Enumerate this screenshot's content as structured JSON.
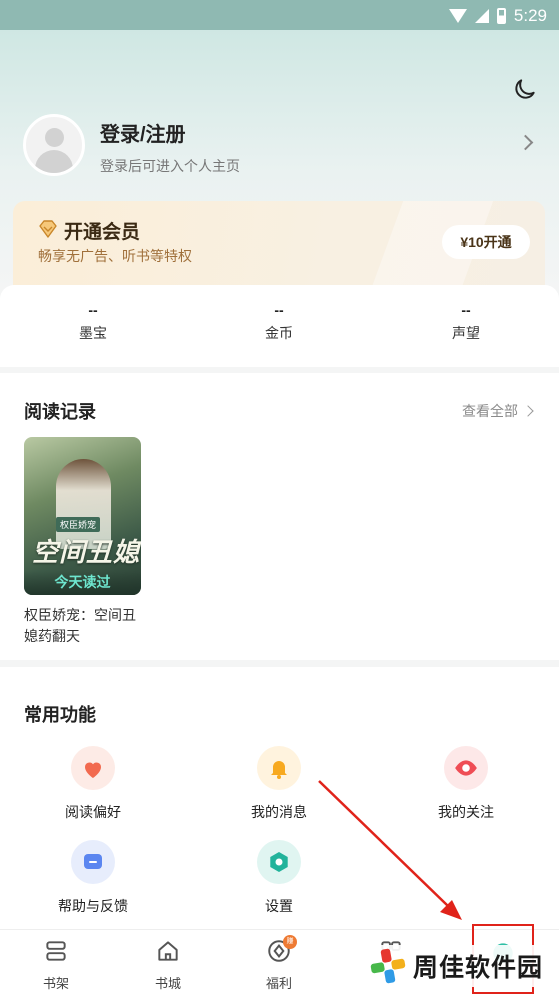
{
  "status_bar": {
    "time": "5:29"
  },
  "profile": {
    "title": "登录/注册",
    "subtitle": "登录后可进入个人主页"
  },
  "vip": {
    "title": "开通会员",
    "subtitle": "畅享无广告、听书等特权",
    "button": "¥10开通"
  },
  "stats": [
    {
      "value": "--",
      "label": "墨宝"
    },
    {
      "value": "--",
      "label": "金币"
    },
    {
      "value": "--",
      "label": "声望"
    }
  ],
  "reading": {
    "title": "阅读记录",
    "see_all": "查看全部",
    "book": {
      "title": "权臣娇宠：空间丑媳药翻天",
      "cover_tag": "权臣娇宠",
      "cover_caption": "空间丑媳",
      "badge": "今天读过"
    }
  },
  "features": {
    "title": "常用功能",
    "items": [
      {
        "label": "阅读偏好",
        "icon": "heart-icon"
      },
      {
        "label": "我的消息",
        "icon": "bell-icon"
      },
      {
        "label": "我的关注",
        "icon": "eye-icon"
      },
      {
        "label": "帮助与反馈",
        "icon": "feedback-icon"
      },
      {
        "label": "设置",
        "icon": "settings-icon"
      }
    ]
  },
  "tabbar": {
    "items": [
      {
        "label": "书架",
        "icon": "bookshelf-icon"
      },
      {
        "label": "书城",
        "icon": "bookstore-icon"
      },
      {
        "label": "福利",
        "icon": "welfare-icon",
        "badge": "赚"
      },
      {
        "label": "",
        "icon": "category-icon"
      },
      {
        "label": "",
        "icon": "profile-icon"
      }
    ]
  },
  "watermark": {
    "text": "周佳软件园"
  },
  "colors": {
    "accent": "#2fbfa5",
    "annotation": "#e0231a",
    "vip_text": "#a0703b"
  }
}
